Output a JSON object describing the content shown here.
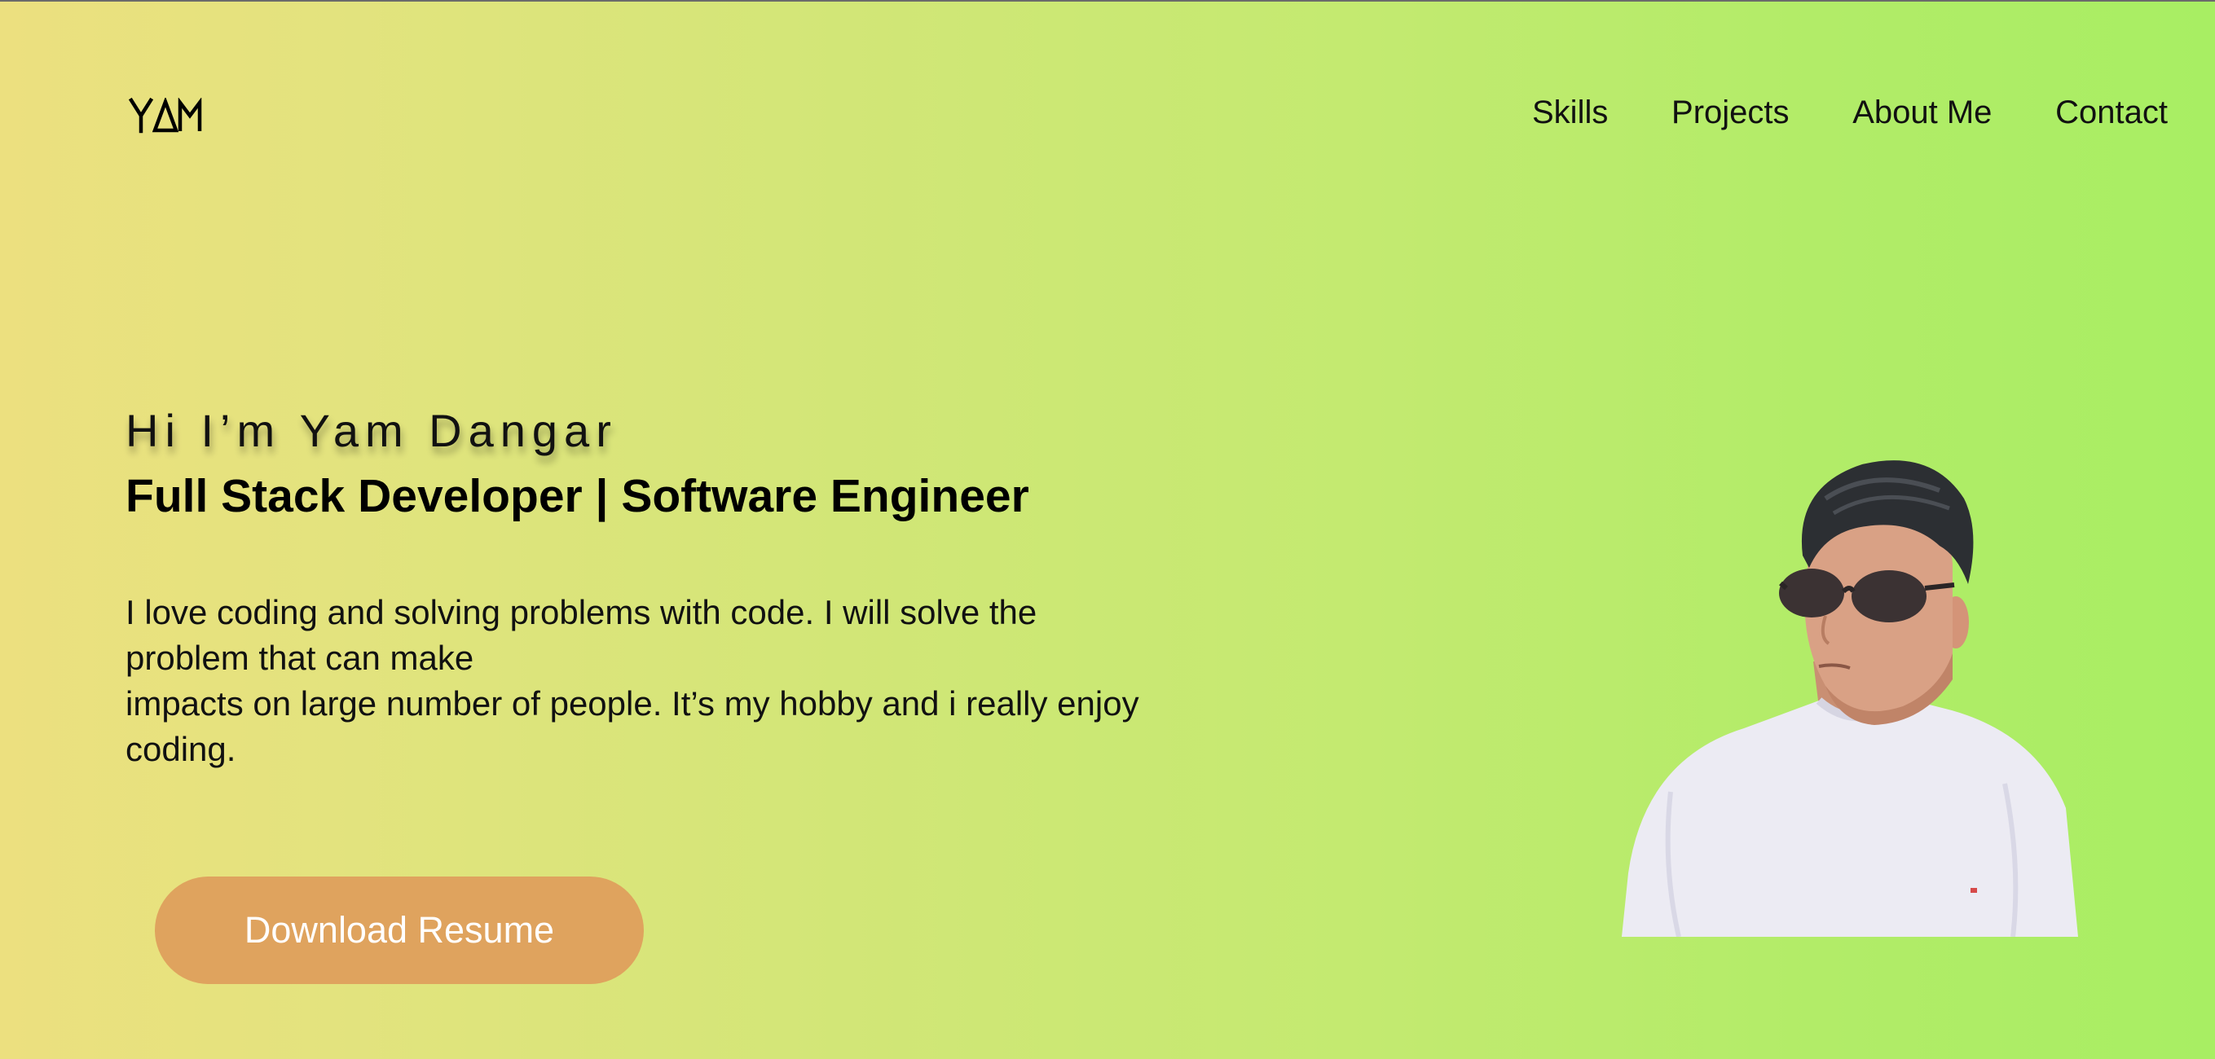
{
  "logo": {
    "text": "YAM",
    "icon": "yam-monogram-logo"
  },
  "nav": {
    "items": [
      {
        "label": "Skills"
      },
      {
        "label": "Projects"
      },
      {
        "label": "About Me"
      },
      {
        "label": "Contact"
      }
    ]
  },
  "hero": {
    "greeting": "Hi I’m Yam Dangar",
    "headline": "Full Stack Developer | Software Engineer",
    "bio_lines": [
      "I love coding and solving problems with code. I will solve the problem that can make",
      "impacts on large number of people. It’s my hobby and i really enjoy coding."
    ],
    "cta_label": "Download Resume",
    "portrait_icon": "profile-photo"
  },
  "colors": {
    "background_start": "#ece07f",
    "background_end": "#a8ee63",
    "button": "#dfa35e",
    "button_text": "#ffffff",
    "text": "#000000"
  }
}
